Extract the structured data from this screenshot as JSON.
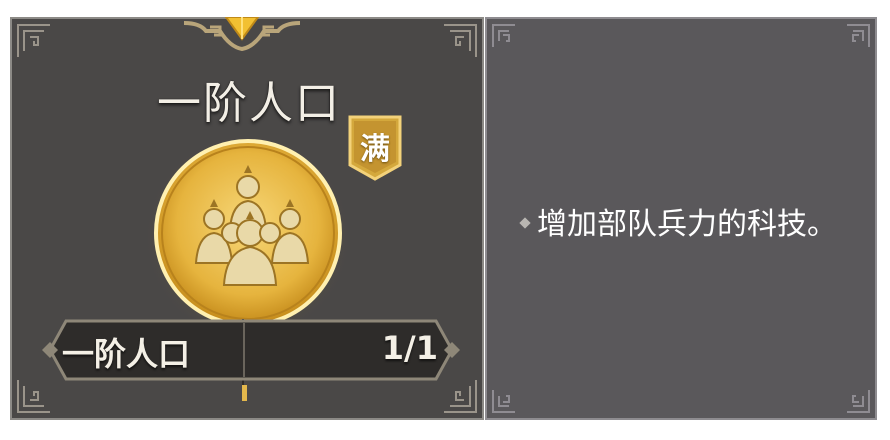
{
  "tech": {
    "title": "一阶人口",
    "status_badge": "满",
    "level_name": "一阶人口",
    "level_progress": "1/1",
    "icon": "soldiers-troop-icon"
  },
  "detail": {
    "description": "增加部队兵力的科技。",
    "bullet_icon": "diamond-bullet-icon"
  },
  "colors": {
    "gold": "#e4b84c",
    "panel_dark": "#4a4847",
    "panel_grey": "#5a585b"
  }
}
